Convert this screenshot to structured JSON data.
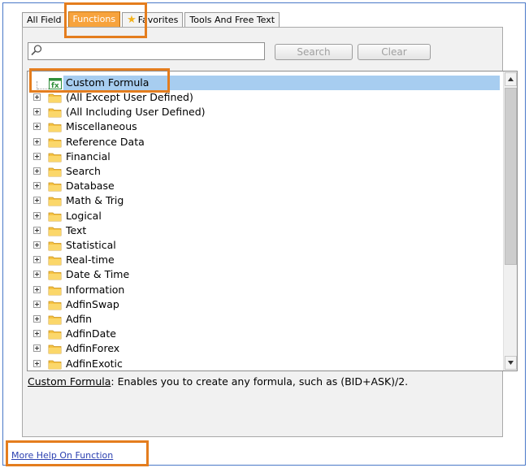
{
  "tabs": [
    {
      "label": "All Field"
    },
    {
      "label": "Functions"
    },
    {
      "label": "Favorites"
    },
    {
      "label": "Tools And Free Text"
    }
  ],
  "search": {
    "placeholder": "",
    "search_label": "Search",
    "clear_label": "Clear"
  },
  "tree": {
    "selected": "Custom Formula",
    "items": [
      {
        "label": "(All Except User Defined)"
      },
      {
        "label": "(All Including User Defined)"
      },
      {
        "label": "Miscellaneous"
      },
      {
        "label": "Reference Data"
      },
      {
        "label": "Financial"
      },
      {
        "label": "Search"
      },
      {
        "label": "Database"
      },
      {
        "label": "Math & Trig"
      },
      {
        "label": "Logical"
      },
      {
        "label": "Text"
      },
      {
        "label": "Statistical"
      },
      {
        "label": "Real-time"
      },
      {
        "label": "Date & Time"
      },
      {
        "label": "Information"
      },
      {
        "label": "AdfinSwap"
      },
      {
        "label": "Adfin"
      },
      {
        "label": "AdfinDate"
      },
      {
        "label": "AdfinForex"
      },
      {
        "label": "AdfinExotic"
      }
    ]
  },
  "description": {
    "term": "Custom Formula",
    "text": ": Enables you to create any formula, such as (BID+ASK)/2."
  },
  "footer": {
    "help_link": "More Help On Function"
  },
  "colors": {
    "highlight": "#e47d1e",
    "active_tab": "#f7a33d",
    "selection": "#a7cdf0",
    "folder": "#f6c343"
  }
}
